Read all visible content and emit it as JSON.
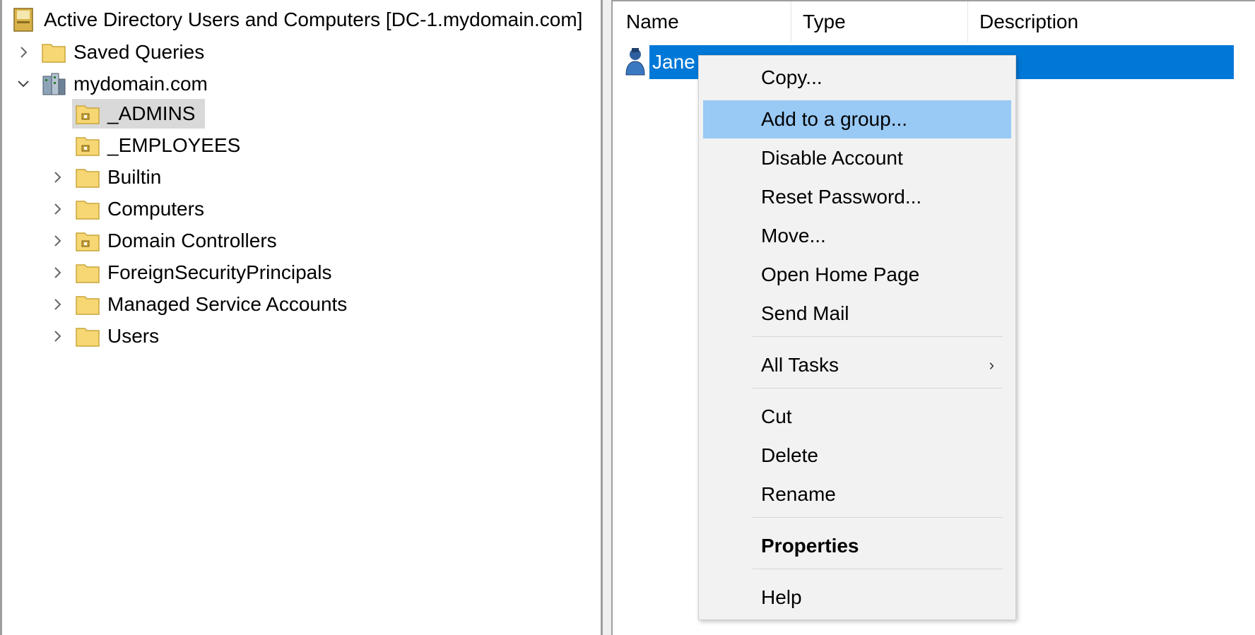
{
  "tree": {
    "root": "Active Directory Users and Computers [DC-1.mydomain.com]",
    "saved_queries": "Saved Queries",
    "domain": "mydomain.com",
    "children": [
      "_ADMINS",
      "_EMPLOYEES",
      "Builtin",
      "Computers",
      "Domain Controllers",
      "ForeignSecurityPrincipals",
      "Managed Service Accounts",
      "Users"
    ]
  },
  "list": {
    "columns": [
      "Name",
      "Type",
      "Description"
    ],
    "rows": [
      {
        "name": "Jane D"
      }
    ]
  },
  "context_menu": {
    "items": [
      "Copy...",
      "Add to a group...",
      "Disable Account",
      "Reset Password...",
      "Move...",
      "Open Home Page",
      "Send Mail",
      "All Tasks",
      "Cut",
      "Delete",
      "Rename",
      "Properties",
      "Help"
    ],
    "submenu_arrow": "›",
    "highlighted": "Add to a group..."
  },
  "colors": {
    "selection": "#0078d7",
    "menu_highlight": "#99c9f5",
    "tree_selection": "#d9d9d9"
  }
}
